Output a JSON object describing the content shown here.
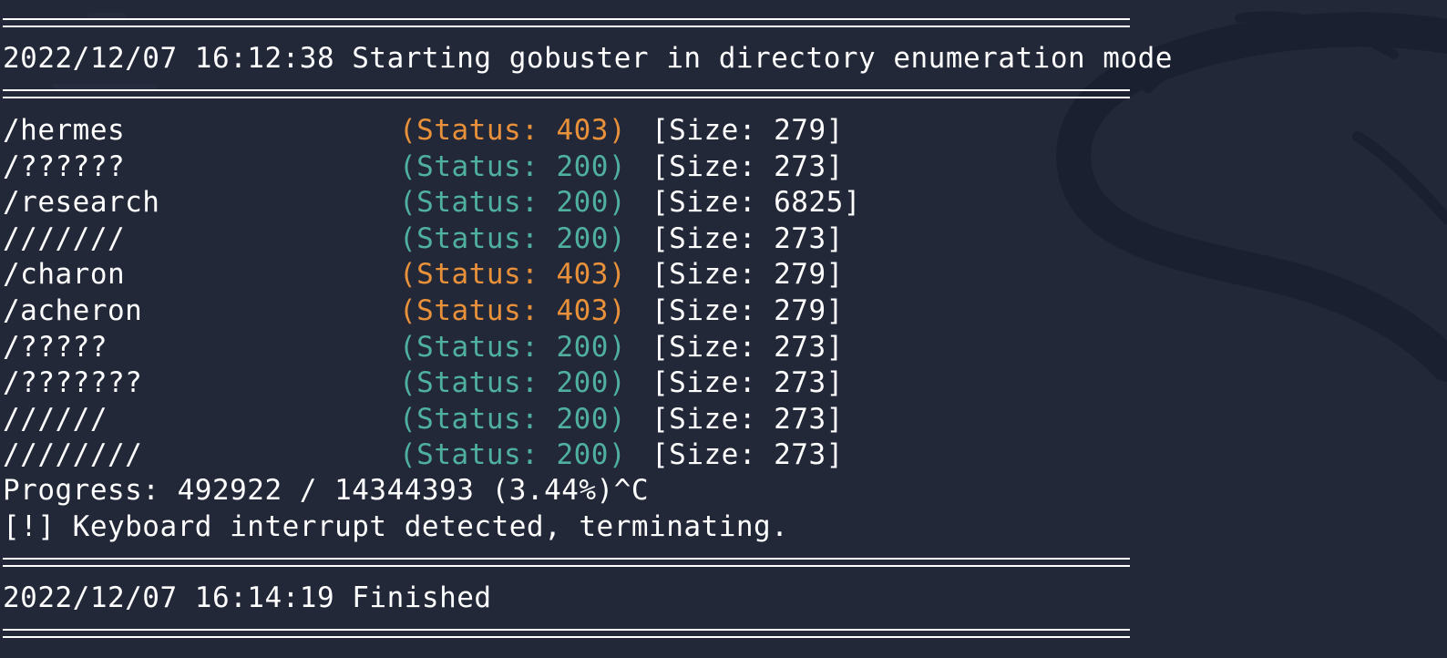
{
  "terminal": {
    "start_line": "2022/12/07 16:12:38 Starting gobuster in directory enumeration mode",
    "results": [
      {
        "path": "/hermes",
        "status": "(Status: 403)",
        "size": "[Size: 279]",
        "code": "403"
      },
      {
        "path": "/??????",
        "status": "(Status: 200)",
        "size": "[Size: 273]",
        "code": "200"
      },
      {
        "path": "/research",
        "status": "(Status: 200)",
        "size": "[Size: 6825]",
        "code": "200"
      },
      {
        "path": "///////",
        "status": "(Status: 200)",
        "size": "[Size: 273]",
        "code": "200"
      },
      {
        "path": "/charon",
        "status": "(Status: 403)",
        "size": "[Size: 279]",
        "code": "403"
      },
      {
        "path": "/acheron",
        "status": "(Status: 403)",
        "size": "[Size: 279]",
        "code": "403"
      },
      {
        "path": "/?????",
        "status": "(Status: 200)",
        "size": "[Size: 273]",
        "code": "200"
      },
      {
        "path": "/???????",
        "status": "(Status: 200)",
        "size": "[Size: 273]",
        "code": "200"
      },
      {
        "path": "//////",
        "status": "(Status: 200)",
        "size": "[Size: 273]",
        "code": "200"
      },
      {
        "path": "////////",
        "status": "(Status: 200)",
        "size": "[Size: 273]",
        "code": "200"
      }
    ],
    "progress_line": "Progress: 492922 / 14344393 (3.44%)^C",
    "interrupt_line": "[!] Keyboard interrupt detected, terminating.",
    "finish_line": "2022/12/07 16:14:19 Finished"
  },
  "colors": {
    "background": "#222838",
    "text": "#ffffff",
    "status_403": "#e8913a",
    "status_200": "#4fb09f"
  },
  "icons": {
    "wallpaper": "kali-dragon-watermark"
  }
}
